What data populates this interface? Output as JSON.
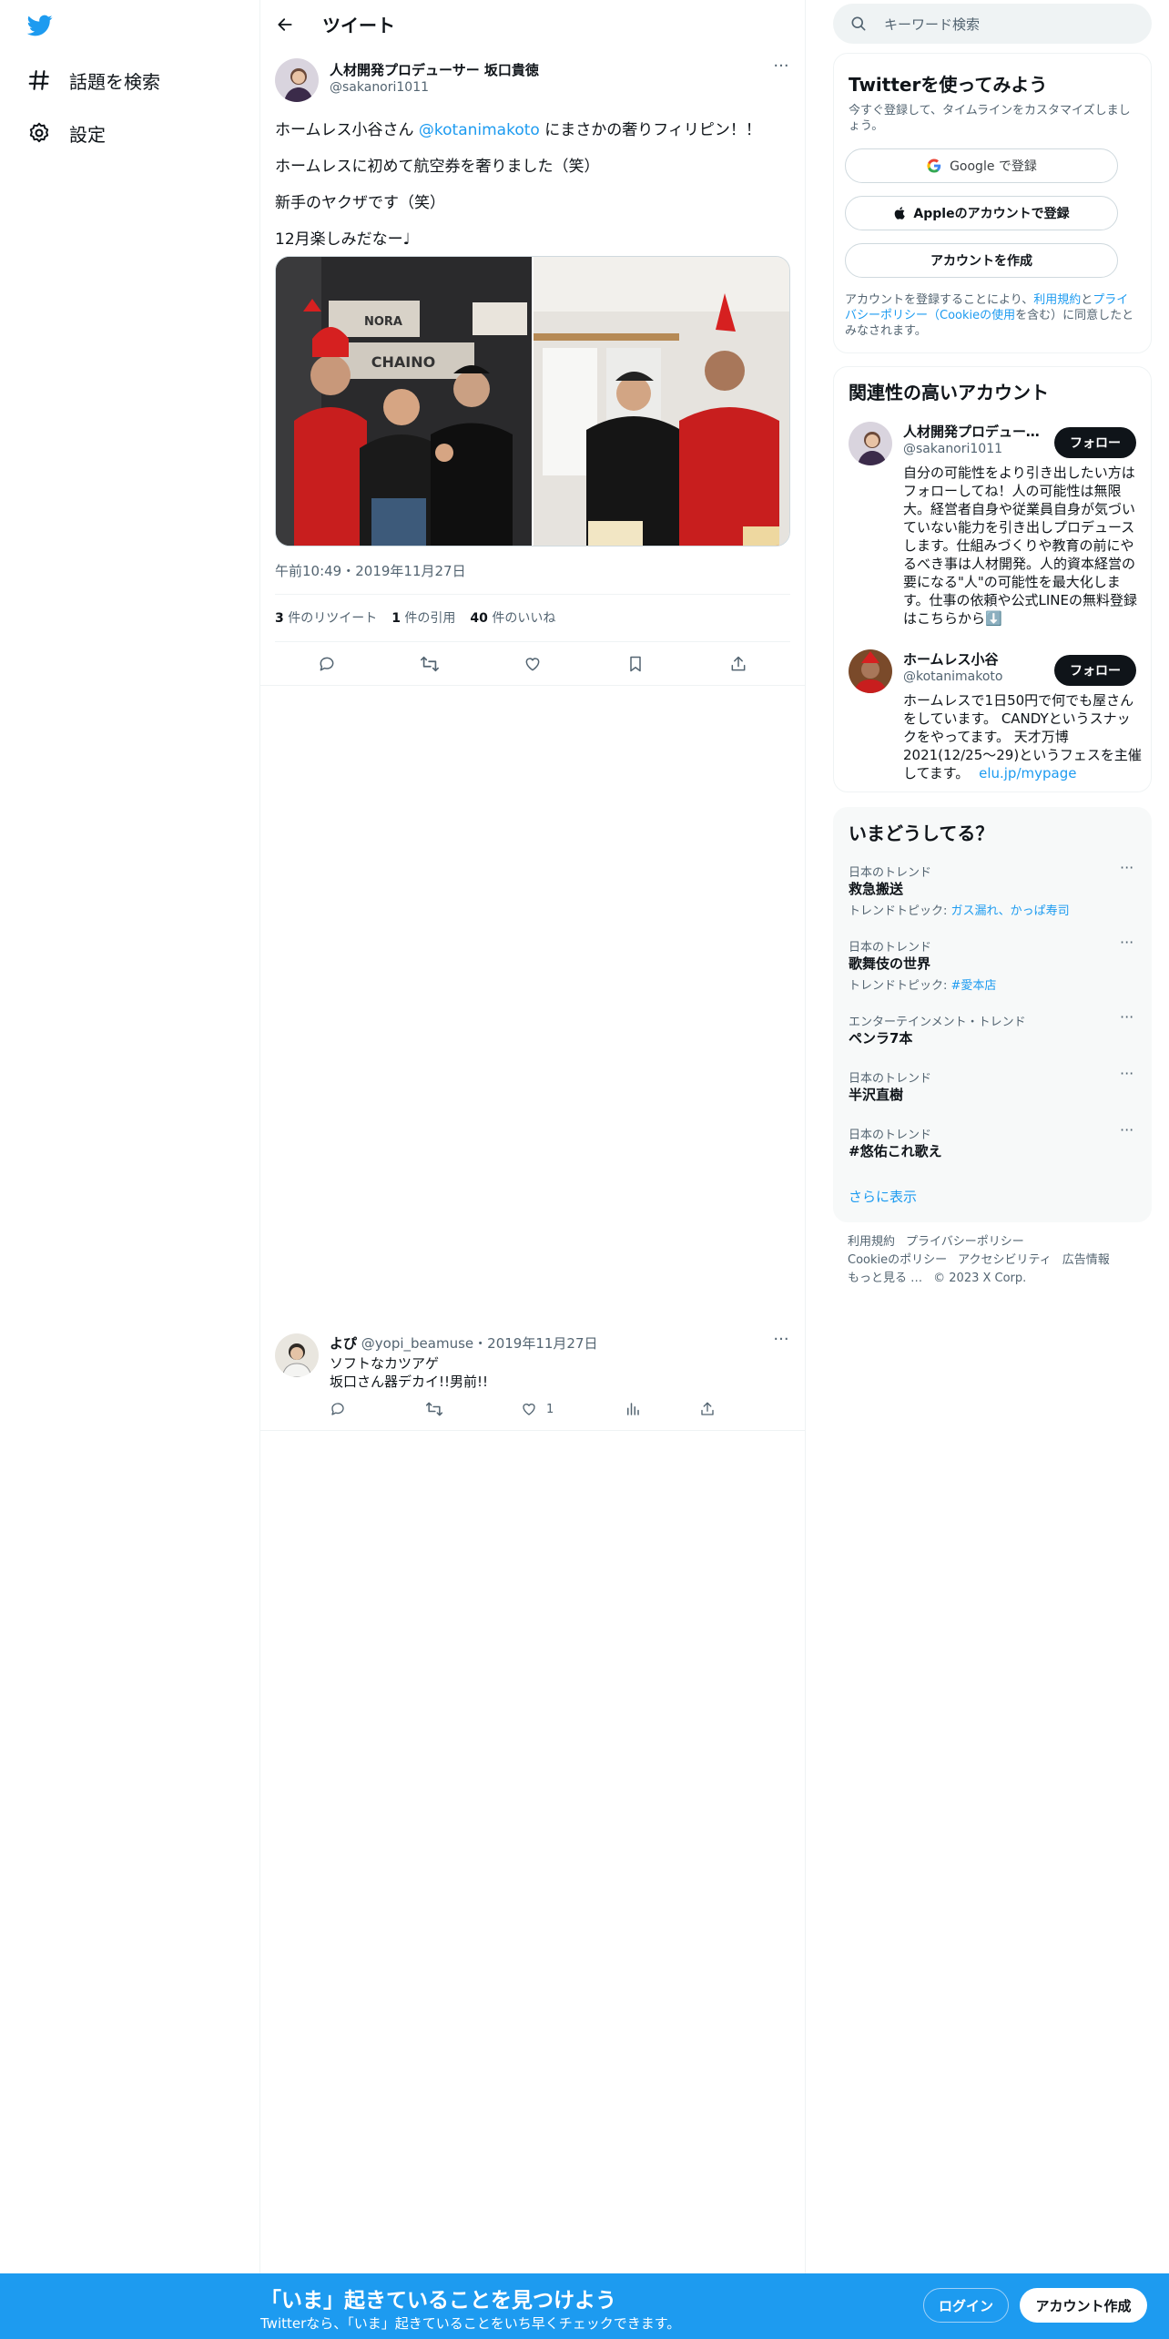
{
  "nav": {
    "explore": "話題を検索",
    "settings": "設定"
  },
  "header": {
    "title": "ツイート"
  },
  "tweet": {
    "name": "人材開発プロデューサー 坂口貴徳",
    "handle": "@sakanori1011",
    "line1_pre": "ホームレス小谷さん ",
    "line1_mention": "@kotanimakoto",
    "line1_post": " にまさかの奢りフィリピン！！",
    "line2": "ホームレスに初めて航空券を奢りました（笑）",
    "line3": "新手のヤクザです（笑）",
    "line4": "12月楽しみだなー♩",
    "timestamp": "午前10:49・2019年11月27日",
    "retweets": "3",
    "retweets_label": " 件のリツイート",
    "quotes": "1",
    "quotes_label": " 件の引用",
    "likes": "40",
    "likes_label": " 件のいいね",
    "photo1_sign_top": "NORA",
    "photo1_sign_bottom": "CHAINO"
  },
  "reply": {
    "name": "よぴ",
    "handle": "@yopi_beamuse",
    "date": "・2019年11月27日",
    "line1": "ソフトなカツアゲ",
    "line2": "坂口さん器デカイ!!男前!!",
    "likes": "1"
  },
  "search": {
    "placeholder": "キーワード検索"
  },
  "signup": {
    "title": "Twitterを使ってみよう",
    "subtitle": "今すぐ登録して、タイムラインをカスタマイズしましょう。",
    "google": "Google で登録",
    "apple": "Appleのアカウントで登録",
    "create": "アカウントを作成",
    "legal_pre": "アカウントを登録することにより、",
    "legal_terms": "利用規約",
    "legal_and": "と",
    "legal_privacy": "プライバシーポリシー（Cookieの使用",
    "legal_post": "を含む）に同意したとみなされます。"
  },
  "related": {
    "title": "関連性の高いアカウント",
    "follow_label": "フォロー",
    "accounts": [
      {
        "name": "人材開発プロデューサー 坂口貴徳",
        "handle": "@sakanori1011",
        "bio": "自分の可能性をより引き出したい方はフォローしてね！人の可能性は無限大。経営者自身や従業員自身が気づいていない能力を引き出しプロデュースします。仕組みづくりや教育の前にやるべき事は人材開発。人的資本経営の要になる\"人\"の可能性を最大化します。仕事の依頼や公式LINEの無料登録はこちらから⬇️"
      },
      {
        "name": "ホームレス小谷",
        "handle": "@kotanimakoto",
        "bio": "ホームレスで1日50円で何でも屋さんをしています。 CANDYというスナックをやってます。 天才万博2021(12/25〜29)というフェスを主催してます。",
        "link": "elu.jp/mypage"
      }
    ]
  },
  "trends": {
    "title": "いまどうしてる？",
    "show_more": "さらに表示",
    "items": [
      {
        "meta": "日本のトレンド",
        "name": "救急搬送",
        "topic_label": "トレンドトピック: ",
        "topic": "ガス漏れ、かっぱ寿司"
      },
      {
        "meta": "日本のトレンド",
        "name": "歌舞伎の世界",
        "topic_label": "トレンドトピック: ",
        "topic": "#愛本店"
      },
      {
        "meta": "エンターテインメント・トレンド",
        "name": "ペンラ7本"
      },
      {
        "meta": "日本のトレンド",
        "name": "半沢直樹"
      },
      {
        "meta": "日本のトレンド",
        "name": "#悠佑これ歌え"
      }
    ]
  },
  "footer": {
    "terms": "利用規約",
    "privacy": "プライバシーポリシー",
    "cookies": "Cookieのポリシー",
    "accessibility": "アクセシビリティ",
    "ads": "広告情報",
    "more": "もっと見る …",
    "copyright": "© 2023 X Corp."
  },
  "banner": {
    "title": "「いま」起きていることを見つけよう",
    "subtitle": "Twitterなら、「いま」起きていることをいち早くチェックできます。",
    "login": "ログイン",
    "signup": "アカウント作成"
  },
  "colors": {
    "accent": "#1d9bf0",
    "text": "#0f1419",
    "muted": "#536471"
  }
}
